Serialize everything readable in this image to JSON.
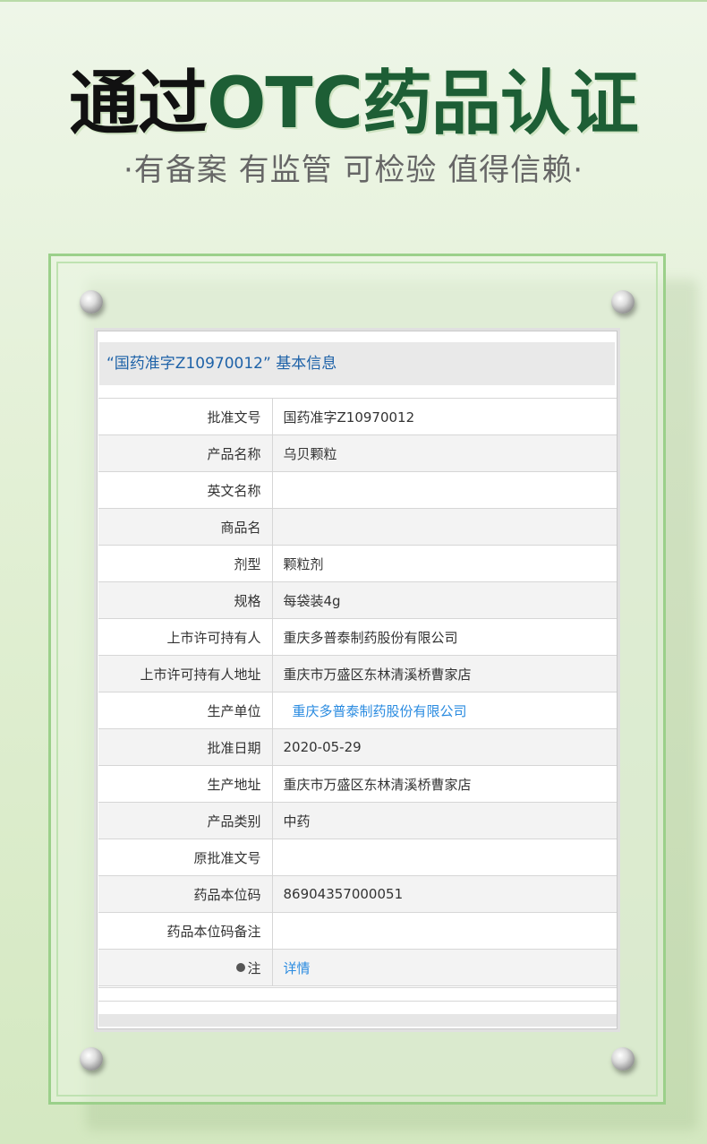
{
  "header": {
    "title_part1": "通过",
    "title_part2": "OTC药品认证",
    "subtitle": "·有备案 有监管 可检验 值得信赖·"
  },
  "card": {
    "title": "“国药准字Z10970012” 基本信息",
    "rows": [
      {
        "label": "批准文号",
        "value": "国药准字Z10970012"
      },
      {
        "label": "产品名称",
        "value": "乌贝颗粒"
      },
      {
        "label": "英文名称",
        "value": ""
      },
      {
        "label": "商品名",
        "value": ""
      },
      {
        "label": "剂型",
        "value": "颗粒剂"
      },
      {
        "label": "规格",
        "value": "每袋装4g"
      },
      {
        "label": "上市许可持有人",
        "value": "重庆多普泰制药股份有限公司"
      },
      {
        "label": "上市许可持有人地址",
        "value": "重庆市万盛区东林清溪桥曹家店"
      },
      {
        "label": "生产单位",
        "value": "重庆多普泰制药股份有限公司"
      },
      {
        "label": "批准日期",
        "value": "2020-05-29"
      },
      {
        "label": "生产地址",
        "value": "重庆市万盛区东林清溪桥曹家店"
      },
      {
        "label": "产品类别",
        "value": "中药"
      },
      {
        "label": "原批准文号",
        "value": ""
      },
      {
        "label": "药品本位码",
        "value": "86904357000051"
      },
      {
        "label": "药品本位码备注",
        "value": ""
      },
      {
        "label": "注",
        "value": "详情"
      }
    ]
  },
  "colors": {
    "title_green": "#1d5e35",
    "link_blue": "#2a8be0",
    "card_title_blue": "#1e62a8",
    "frame_green": "#9bd08a"
  },
  "icons": [
    "bulb-icon",
    "screw-icon"
  ]
}
